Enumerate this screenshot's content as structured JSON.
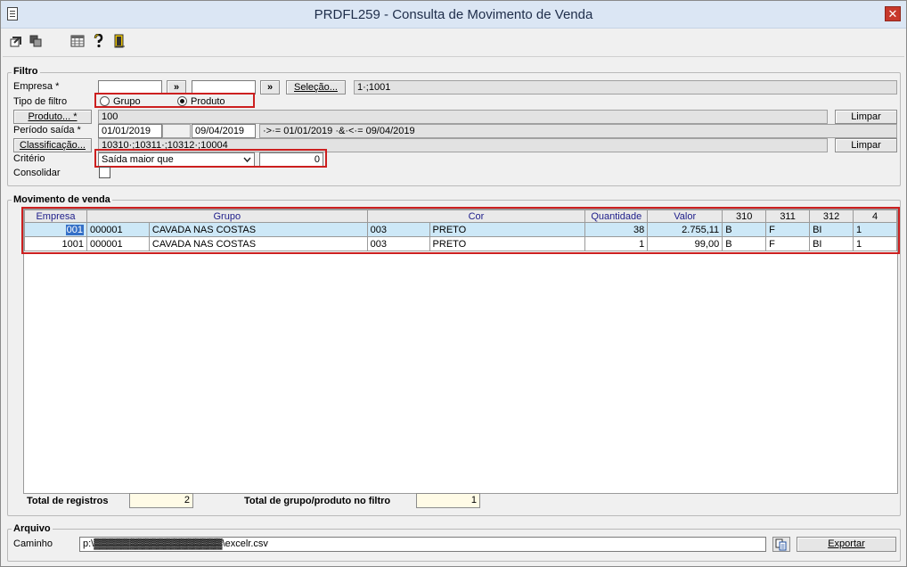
{
  "window": {
    "title": "PRDFL259 - Consulta de Movimento de Venda",
    "close_glyph": "✕"
  },
  "toolbar": {
    "icons": [
      "execute-icon",
      "copy-icon",
      "grid-icon",
      "help-icon",
      "exit-icon"
    ]
  },
  "filter": {
    "title": "Filtro",
    "empresa_label": "Empresa *",
    "empresa_value_1": "",
    "empresa_value_2": "",
    "arrow_1": "»",
    "arrow_2": "»",
    "selecao_button": "Seleção...",
    "empresa_selection": "1·;1001",
    "tipo_filtro_label": "Tipo de filtro",
    "radio_grupo": "Grupo",
    "radio_produto": "Produto",
    "radio_selected": "Produto",
    "produto_button": "Produto... *",
    "produto_value": "100",
    "limpar_1": "Limpar",
    "periodo_label": "Período saída *",
    "periodo_from": "01/01/2019",
    "periodo_to": "09/04/2019",
    "periodo_summary": "·>·= 01/01/2019 ·&·<·= 09/04/2019",
    "classificacao_button": "Classificação...",
    "classificacao_value": "10310·;10311·;10312·;10004",
    "limpar_2": "Limpar",
    "criterio_label": "Critério",
    "criterio_value": "Saída maior que",
    "criterio_number": "0",
    "consolidar_label": "Consolidar",
    "consolidar_checked": false
  },
  "movimento": {
    "title": "Movimento de venda",
    "columns": [
      "Empresa",
      "Grupo",
      "Cor",
      "Quantidade",
      "Valor",
      "310",
      "311",
      "312",
      "4"
    ],
    "rows": [
      {
        "empresa": "001",
        "grupo_code": "000001",
        "grupo_name": "CAVADA NAS COSTAS",
        "cor_code": "003",
        "cor_name": "PRETO",
        "quantidade": "38",
        "valor": "2.755,11",
        "c310": "B",
        "c311": "F",
        "c312": "BI",
        "c4": "1"
      },
      {
        "empresa": "1001",
        "grupo_code": "000001",
        "grupo_name": "CAVADA NAS COSTAS",
        "cor_code": "003",
        "cor_name": "PRETO",
        "quantidade": "1",
        "valor": "99,00",
        "c310": "B",
        "c311": "F",
        "c312": "BI",
        "c4": "1"
      }
    ],
    "total_registros_label": "Total de registros",
    "total_registros_value": "2",
    "total_grupo_label": "Total de grupo/produto no filtro",
    "total_grupo_value": "1"
  },
  "arquivo": {
    "title": "Arquivo",
    "caminho_label": "Caminho",
    "caminho_value": "p:\\▓▓▓▓▓▓▓▓▓▓▓▓▓▓▓▓▓▓\\excelr.csv",
    "exportar_button": "Exportar"
  },
  "colors": {
    "highlight_box": "#cc1f1f",
    "selected_row": "#cde8f7",
    "header_text": "#1d1d8a"
  }
}
